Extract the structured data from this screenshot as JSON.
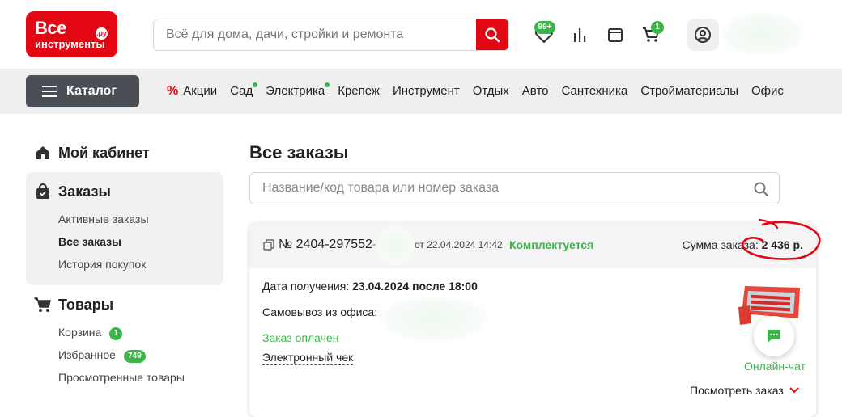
{
  "header": {
    "logo_line1": "Все",
    "logo_line2": "инструменты",
    "logo_ru": ".ру",
    "search_placeholder": "Всё для дома, дачи, стройки и ремонта",
    "favorites_badge": "99+",
    "cart_badge": "1"
  },
  "nav": {
    "catalog_label": "Каталог",
    "items": [
      {
        "label": "Акции"
      },
      {
        "label": "Сад"
      },
      {
        "label": "Электрика"
      },
      {
        "label": "Крепеж"
      },
      {
        "label": "Инструмент"
      },
      {
        "label": "Отдых"
      },
      {
        "label": "Авто"
      },
      {
        "label": "Сантехника"
      },
      {
        "label": "Стройматериалы"
      },
      {
        "label": "Офис"
      }
    ]
  },
  "sidebar": {
    "cabinet": "Мой кабинет",
    "orders": "Заказы",
    "orders_links": [
      "Активные заказы",
      "Все заказы",
      "История покупок"
    ],
    "goods": "Товары",
    "goods_links": [
      "Корзина",
      "Избранное",
      "Просмотренные товары"
    ],
    "cart_count": "1",
    "favorites_count": "749"
  },
  "main": {
    "title": "Все заказы",
    "search_placeholder": "Название/код товара или номер заказа"
  },
  "order": {
    "number": "№ 2404-297552-",
    "date": "от 22.04.2024 14:42",
    "status": "Комплектуется",
    "sum_label": "Сумма заказа:",
    "sum_value": "2 436 р.",
    "receive_label": "Дата получения:",
    "receive_value": "23.04.2024 после 18:00",
    "pickup_label": "Самовывоз из офиса:",
    "paid": "Заказ оплачен",
    "receipt": "Электронный чек",
    "chat": "Онлайн-чат",
    "view": "Посмотреть заказ"
  },
  "colors": {
    "brand_red": "#e30613",
    "status_green": "#3ab54a",
    "nav_bg": "#efefef",
    "catalog_btn": "#4a4f55"
  }
}
